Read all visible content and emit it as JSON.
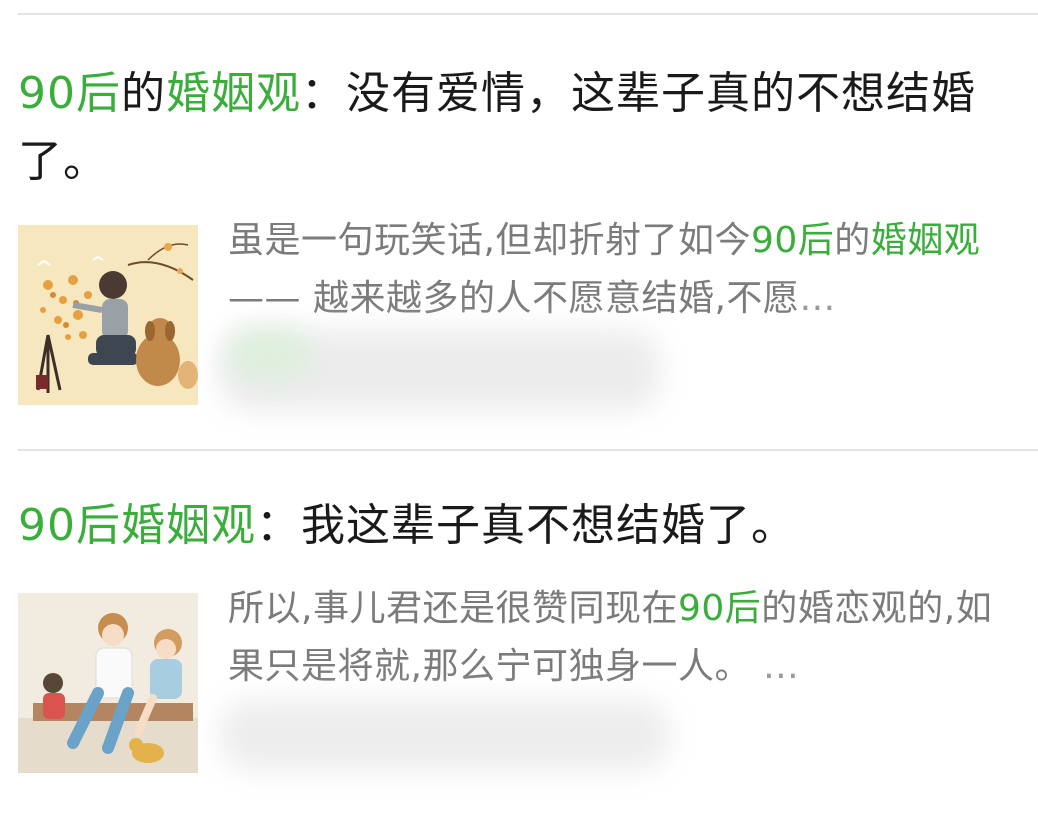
{
  "results": [
    {
      "title_parts": [
        {
          "text": "90后",
          "highlight": true
        },
        {
          "text": "的",
          "highlight": false
        },
        {
          "text": "婚姻观",
          "highlight": true
        },
        {
          "text": "：没有爱情，这辈子真的不想结婚了。",
          "highlight": false
        }
      ],
      "thumbnail": "illustration-girl-painting-with-dog",
      "snippet_parts": [
        {
          "text": "虽是一句玩笑话,但却折射了如今",
          "highlight": false
        },
        {
          "text": "90后",
          "highlight": true
        },
        {
          "text": "的",
          "highlight": false
        },
        {
          "text": "婚姻观",
          "highlight": true
        },
        {
          "text": "—— 越来越多的人不愿意结婚,不愿",
          "highlight": false
        },
        {
          "text": "…",
          "highlight": false
        }
      ]
    },
    {
      "title_parts": [
        {
          "text": "90后婚姻观",
          "highlight": true
        },
        {
          "text": "：我这辈子真不想结婚了。",
          "highlight": false
        }
      ],
      "thumbnail": "illustration-couple-sitting-with-dog",
      "snippet_parts": [
        {
          "text": "所以,事儿君还是很赞同现在",
          "highlight": false
        },
        {
          "text": "90后",
          "highlight": true
        },
        {
          "text": "的婚恋观的,如果只是将就,那么宁可独身一人。",
          "highlight": false
        },
        {
          "text": " …",
          "highlight": false
        }
      ]
    }
  ],
  "colors": {
    "highlight": "#3aae3a",
    "snippet": "#7b7b7b",
    "title": "#1a1a1a",
    "divider": "#e4e4e4"
  }
}
